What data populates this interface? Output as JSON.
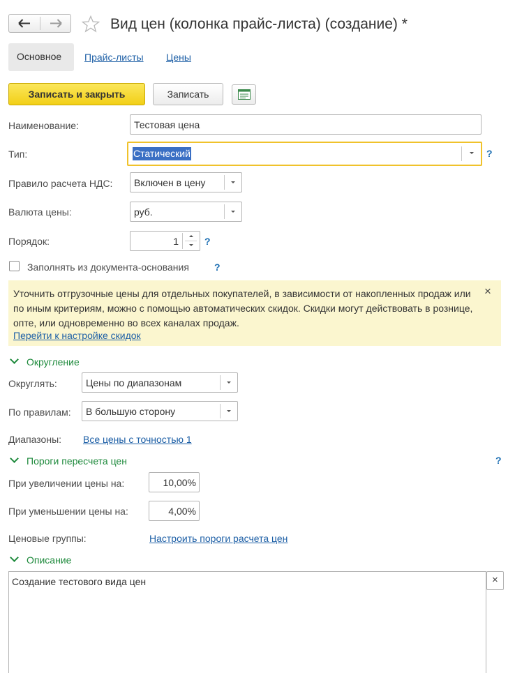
{
  "window": {
    "title": "Вид цен (колонка прайс-листа) (создание) *",
    "back_icon": "arrow-left-icon",
    "forward_icon": "arrow-right-icon",
    "favorite_icon": "star-icon"
  },
  "tabs": {
    "main": "Основное",
    "price_lists": "Прайс-листы",
    "prices": "Цены"
  },
  "toolbar": {
    "save_close": "Записать и закрыть",
    "save": "Записать",
    "report_icon": "report-icon"
  },
  "form": {
    "name_label": "Наименование:",
    "name_value": "Тестовая цена",
    "type_label": "Тип:",
    "type_value": "Статический",
    "vat_label": "Правило расчета НДС:",
    "vat_value": "Включен в цену",
    "currency_label": "Валюта цены:",
    "currency_value": "руб.",
    "order_label": "Порядок:",
    "order_value": "1",
    "fill_from_base_label": "Заполнять из документа-основания",
    "fill_from_base_checked": false,
    "help_mark": "?"
  },
  "info": {
    "text": "Уточнить отгрузочные цены для отдельных покупателей, в зависимости от накопленных продаж или по иным критериям, можно с помощью автоматических скидок. Скидки могут действовать в рознице, опте, или одновременно во всех каналах продаж.",
    "link": "Перейти к настройке скидок",
    "close": "×"
  },
  "rounding": {
    "title": "Округление",
    "round_label": "Округлять:",
    "round_value": "Цены по диапазонам",
    "rule_label": "По правилам:",
    "rule_value": "В большую сторону",
    "ranges_label": "Диапазоны:",
    "ranges_link": "Все цены с точностью 1"
  },
  "thresholds": {
    "title": "Пороги пересчета цен",
    "increase_label": "При увеличении цены на:",
    "increase_value": "10,00%",
    "decrease_label": "При уменьшении цены на:",
    "decrease_value": "4,00%",
    "groups_label": "Ценовые группы:",
    "groups_link": "Настроить пороги расчета цен"
  },
  "description": {
    "title": "Описание",
    "text": "Создание тестового вида цен",
    "clear": "×"
  },
  "colors": {
    "accent_yellow": "#f8dc2f",
    "info_bg": "#fbf6cf",
    "link": "#1d5fa6",
    "group_green": "#1e8a3c",
    "focus_border": "#f0c22b"
  }
}
